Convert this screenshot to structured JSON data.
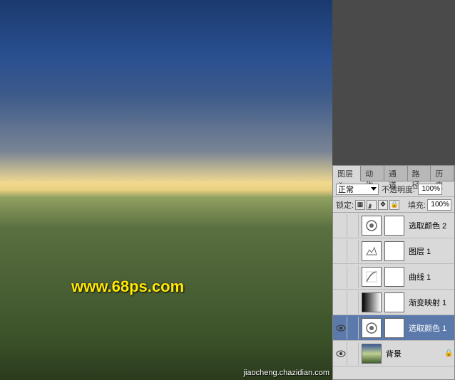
{
  "watermarks": {
    "main": "www.68ps.com",
    "secondary": "jiaocheng.chazidian.com"
  },
  "panel": {
    "tabs": [
      {
        "label": "图层",
        "active": true
      },
      {
        "label": "动作"
      },
      {
        "label": "通道"
      },
      {
        "label": "路径"
      },
      {
        "label": "历史"
      }
    ],
    "blend_mode": "正常",
    "opacity_label": "不透明度:",
    "opacity_value": "100%",
    "lock_label": "锁定:",
    "fill_label": "填充:",
    "fill_value": "100%",
    "layers": [
      {
        "visible": false,
        "type": "selective-color",
        "mask": true,
        "name": "选取颜色 2",
        "selected": false
      },
      {
        "visible": false,
        "type": "levels",
        "mask": true,
        "name": "图层 1",
        "selected": false
      },
      {
        "visible": false,
        "type": "curves",
        "mask": true,
        "name": "曲线 1",
        "selected": false
      },
      {
        "visible": false,
        "type": "gradient-map",
        "mask": true,
        "name": "渐变映射 1",
        "selected": false
      },
      {
        "visible": true,
        "type": "selective-color",
        "mask": true,
        "name": "选取颜色 1",
        "selected": true
      },
      {
        "visible": true,
        "type": "background",
        "mask": false,
        "name": "背景",
        "locked": true,
        "selected": false
      }
    ]
  }
}
